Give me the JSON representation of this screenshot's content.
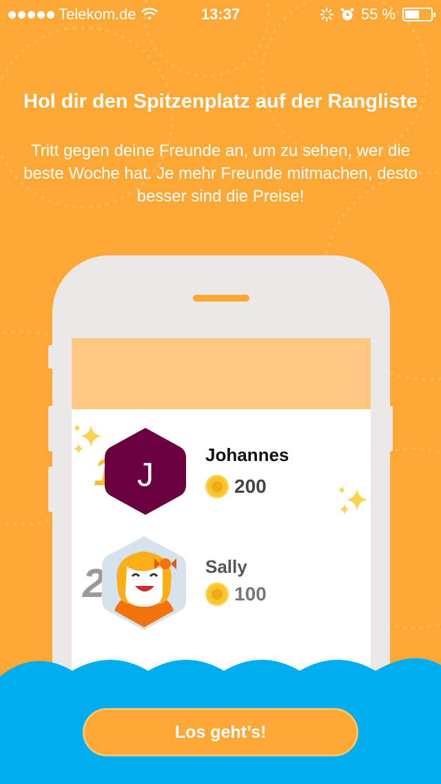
{
  "status_bar": {
    "carrier": "Telekom.de",
    "time": "13:37",
    "battery": "55 %",
    "battery_level": 0.55
  },
  "onboarding": {
    "title": "Hol dir den Spitzenplatz auf der Rangliste",
    "subtitle": "Tritt gegen deine Freunde an, um zu sehen, wer die beste Woche hat. Je mehr Freunde mitmachen, desto besser sind die Preise!"
  },
  "leaderboard": [
    {
      "rank": "1",
      "initial": "J",
      "name": "Johannes",
      "score": "200"
    },
    {
      "rank": "2",
      "name": "Sally",
      "score": "100"
    }
  ],
  "cta": {
    "label": "Los geht’s!"
  },
  "colors": {
    "background": "#FDA734",
    "wave": "#00AEEF",
    "avatar_johannes": "#6A003F",
    "coin": "#F8C427"
  }
}
